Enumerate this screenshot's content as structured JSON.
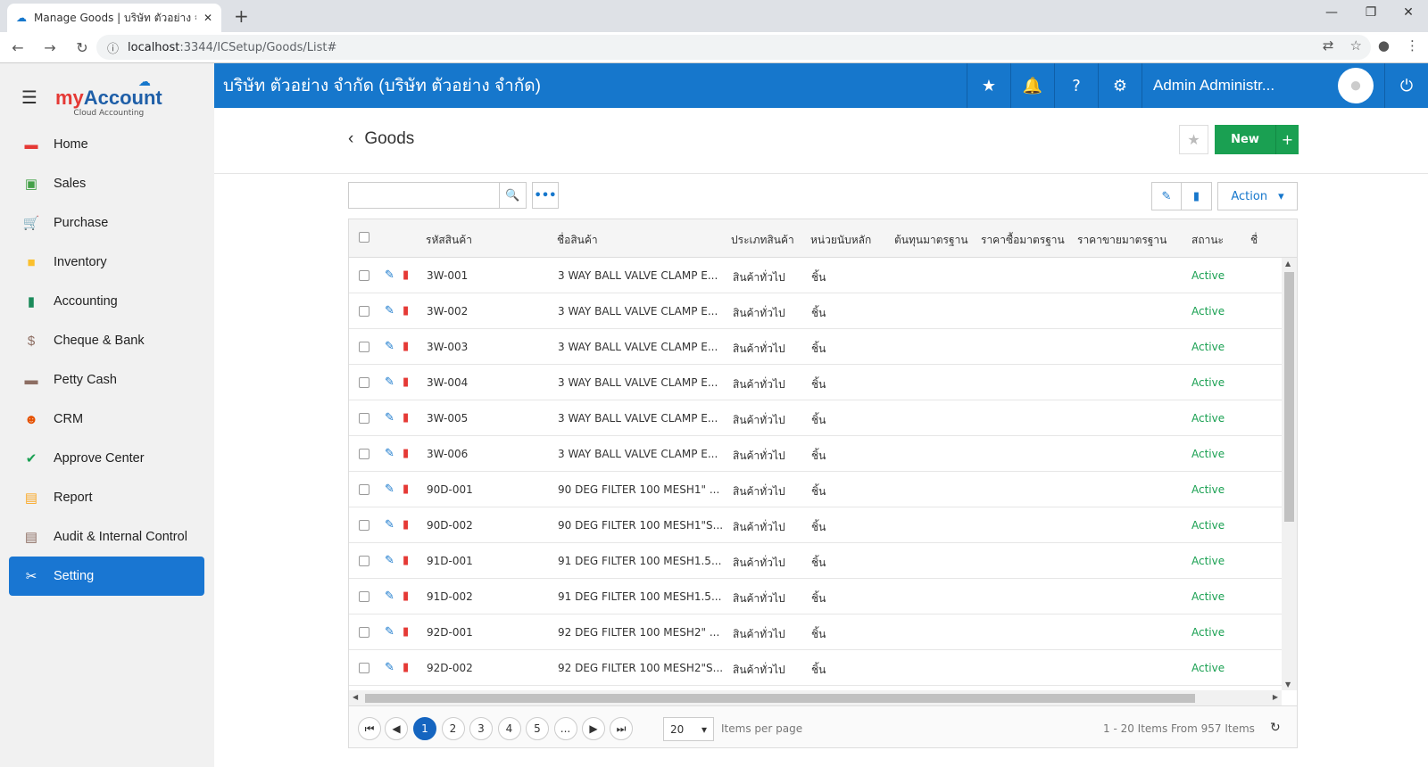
{
  "browser": {
    "tab_title": "Manage Goods | บริษัท ตัวอย่าง จำกัด",
    "close_glyph": "✕",
    "newtab_glyph": "+",
    "url_host": "localhost",
    "url_path": ":3344/ICSetup/Goods/List#"
  },
  "logo": {
    "brand_my": "my",
    "brand_account": "Account",
    "subtitle": "Cloud Accounting"
  },
  "sidebar": {
    "items": [
      {
        "label": "Home",
        "icon": "home-icon",
        "glyph": "▬",
        "color": "#e53935"
      },
      {
        "label": "Sales",
        "icon": "money-icon",
        "glyph": "▣",
        "color": "#43a047"
      },
      {
        "label": "Purchase",
        "icon": "cart-icon",
        "glyph": "🛒",
        "color": "#e53935"
      },
      {
        "label": "Inventory",
        "icon": "box-icon",
        "glyph": "■",
        "color": "#fbc02d"
      },
      {
        "label": "Accounting",
        "icon": "book-icon",
        "glyph": "▮",
        "color": "#1b8a5a"
      },
      {
        "label": "Cheque & Bank",
        "icon": "bank-icon",
        "glyph": "$",
        "color": "#8d6e63"
      },
      {
        "label": "Petty Cash",
        "icon": "wallet-icon",
        "glyph": "▬",
        "color": "#8d6e63"
      },
      {
        "label": "CRM",
        "icon": "people-icon",
        "glyph": "☻",
        "color": "#e65100"
      },
      {
        "label": "Approve Center",
        "icon": "check-icon",
        "glyph": "✔",
        "color": "#1aa052"
      },
      {
        "label": "Report",
        "icon": "report-icon",
        "glyph": "▤",
        "color": "#f9a825"
      },
      {
        "label": "Audit & Internal Control",
        "icon": "clipboard-icon",
        "glyph": "▤",
        "color": "#8d6e63"
      },
      {
        "label": "Setting",
        "icon": "tools-icon",
        "glyph": "✂",
        "color": "#ffffff"
      }
    ]
  },
  "topbar": {
    "company": "บริษัท ตัวอย่าง จำกัด (บริษัท ตัวอย่าง จำกัด)",
    "user": "Admin Administr..."
  },
  "page": {
    "title": "Goods",
    "new_label": "New"
  },
  "toolbar": {
    "action_label": "Action"
  },
  "grid": {
    "columns": [
      "รหัสสินค้า",
      "ชื่อสินค้า",
      "ประเภทสินค้า",
      "หน่วยนับหลัก",
      "ต้นทุนมาตรฐาน",
      "ราคาซื้อมาตรฐาน",
      "ราคาขายมาตรฐาน",
      "สถานะ",
      "ชื่"
    ],
    "rows": [
      {
        "code": "3W-001",
        "name": "3 WAY BALL VALVE CLAMP E...",
        "type": "สินค้าทั่วไป",
        "unit": "ชิ้น",
        "status": "Active"
      },
      {
        "code": "3W-002",
        "name": "3 WAY BALL VALVE CLAMP E...",
        "type": "สินค้าทั่วไป",
        "unit": "ชิ้น",
        "status": "Active"
      },
      {
        "code": "3W-003",
        "name": "3 WAY BALL VALVE CLAMP E...",
        "type": "สินค้าทั่วไป",
        "unit": "ชิ้น",
        "status": "Active"
      },
      {
        "code": "3W-004",
        "name": "3 WAY BALL VALVE CLAMP E...",
        "type": "สินค้าทั่วไป",
        "unit": "ชิ้น",
        "status": "Active"
      },
      {
        "code": "3W-005",
        "name": "3 WAY BALL VALVE CLAMP E...",
        "type": "สินค้าทั่วไป",
        "unit": "ชิ้น",
        "status": "Active"
      },
      {
        "code": "3W-006",
        "name": "3 WAY BALL VALVE CLAMP E...",
        "type": "สินค้าทั่วไป",
        "unit": "ชิ้น",
        "status": "Active"
      },
      {
        "code": "90D-001",
        "name": "90 DEG FILTER 100 MESH1\" ...",
        "type": "สินค้าทั่วไป",
        "unit": "ชิ้น",
        "status": "Active"
      },
      {
        "code": "90D-002",
        "name": "90 DEG FILTER 100 MESH1\"S...",
        "type": "สินค้าทั่วไป",
        "unit": "ชิ้น",
        "status": "Active"
      },
      {
        "code": "91D-001",
        "name": "91 DEG FILTER 100 MESH1.5...",
        "type": "สินค้าทั่วไป",
        "unit": "ชิ้น",
        "status": "Active"
      },
      {
        "code": "91D-002",
        "name": "91 DEG FILTER 100 MESH1.5...",
        "type": "สินค้าทั่วไป",
        "unit": "ชิ้น",
        "status": "Active"
      },
      {
        "code": "92D-001",
        "name": "92 DEG FILTER 100 MESH2\" ...",
        "type": "สินค้าทั่วไป",
        "unit": "ชิ้น",
        "status": "Active"
      },
      {
        "code": "92D-002",
        "name": "92 DEG FILTER 100 MESH2\"S...",
        "type": "สินค้าทั่วไป",
        "unit": "ชิ้น",
        "status": "Active"
      }
    ]
  },
  "pager": {
    "pages": [
      "1",
      "2",
      "3",
      "4",
      "5",
      "..."
    ],
    "current": "1",
    "per_page": "20",
    "per_page_label": "Items per page",
    "range": "1 - 20 Items From 957 Items"
  }
}
